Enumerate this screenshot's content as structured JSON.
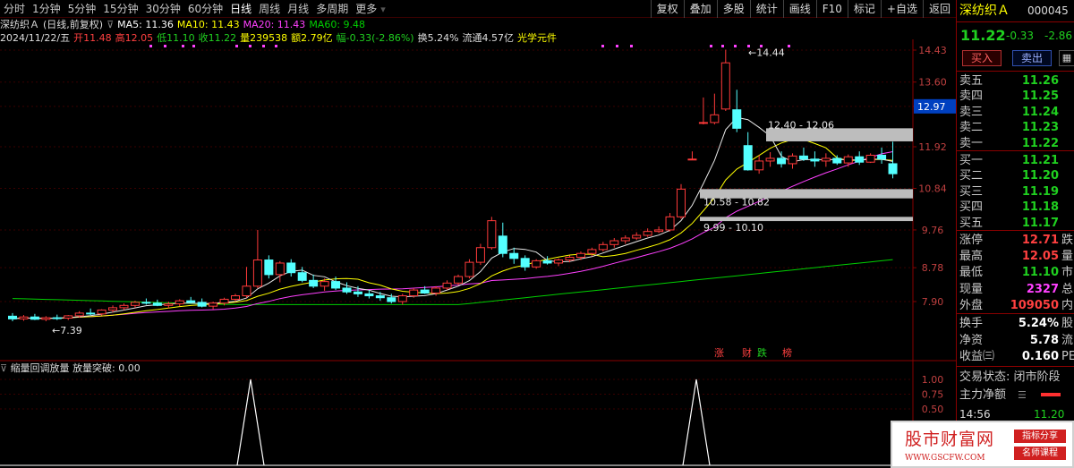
{
  "toolbar": {
    "periods": [
      "分时",
      "1分钟",
      "5分钟",
      "15分钟",
      "30分钟",
      "60分钟",
      "日线",
      "周线",
      "月线",
      "多周期",
      "更多"
    ],
    "active_period": "日线",
    "buttons": [
      "复权",
      "叠加",
      "多股",
      "统计",
      "画线",
      "F10",
      "标记",
      "+自选",
      "返回"
    ]
  },
  "info": {
    "stock": "深纺织Ａ",
    "mode": "(日线,前复权)",
    "ma5": "MA5: 11.36",
    "ma10": "MA10: 11.43",
    "ma20": "MA20: 11.43",
    "ma60": "MA60: 9.48",
    "date": "2024/11/22/五",
    "open": "开11.48",
    "high": "高12.05",
    "low": "低11.10",
    "close": "收11.22",
    "vol": "量239538",
    "amount": "额2.79亿",
    "change": "幅-0.33(-2.86%)",
    "turnover": "换5.24%",
    "float": "流通4.57亿",
    "concept": "光学元件",
    "colors": {
      "ma5": "#ffffff",
      "ma10": "#ffff00",
      "ma20": "#ff40ff",
      "ma60": "#00d000"
    }
  },
  "kchart": {
    "y_labels": [
      "14.43",
      "13.60",
      "12.97",
      "11.92",
      "10.84",
      "9.76",
      "8.78",
      "7.90"
    ],
    "current_price_tag": "12.97",
    "annotations": {
      "high": "14.44",
      "low": "7.39",
      "box1": "12.40 - 12.06",
      "box2": "10.58 - 10.82",
      "box3": "9.99 - 10.10"
    },
    "markers": [
      "涨",
      "财",
      "跌",
      "榜"
    ]
  },
  "indicator": {
    "title": "缩量回调放量",
    "value_label": "放量突破: 0.00",
    "y_labels": [
      "1.00",
      "0.75",
      "0.50"
    ]
  },
  "panel": {
    "name": "深纺织Ａ",
    "code": "000045",
    "price": "11.22",
    "change": "-0.33",
    "change_pct": "-2.86",
    "buy_label": "买入",
    "sell_label": "卖出",
    "asks": [
      {
        "label": "卖五",
        "price": "11.26"
      },
      {
        "label": "卖四",
        "price": "11.25"
      },
      {
        "label": "卖三",
        "price": "11.24"
      },
      {
        "label": "卖二",
        "price": "11.23"
      },
      {
        "label": "卖一",
        "price": "11.22"
      }
    ],
    "bids": [
      {
        "label": "买一",
        "price": "11.21"
      },
      {
        "label": "买二",
        "price": "11.20"
      },
      {
        "label": "买三",
        "price": "11.19"
      },
      {
        "label": "买四",
        "price": "11.18"
      },
      {
        "label": "买五",
        "price": "11.17"
      }
    ],
    "stats": [
      {
        "label": "涨停",
        "value": "12.71",
        "cut": "跌",
        "color": "red"
      },
      {
        "label": "最高",
        "value": "12.05",
        "cut": "量",
        "color": "red"
      },
      {
        "label": "最低",
        "value": "11.10",
        "cut": "市",
        "color": "green"
      },
      {
        "label": "现量",
        "value": "2327",
        "cut": "总",
        "color": "magenta"
      },
      {
        "label": "外盘",
        "value": "109050",
        "cut": "内",
        "color": "red"
      }
    ],
    "stats2": [
      {
        "label": "换手",
        "value": "5.24%",
        "cut": "股"
      },
      {
        "label": "净资",
        "value": "5.78",
        "cut": "流"
      },
      {
        "label": "收益㈢",
        "value": "0.160",
        "cut": "PE"
      }
    ],
    "trade_status": "交易状态: 闭市阶段",
    "main_net": "主力净额",
    "time": "14:56",
    "time_price": "11.20"
  },
  "watermark": {
    "main": "股市财富网",
    "url": "WWW.GSCFW.COM",
    "tag1": "指标分享",
    "tag2": "名师课程"
  }
}
